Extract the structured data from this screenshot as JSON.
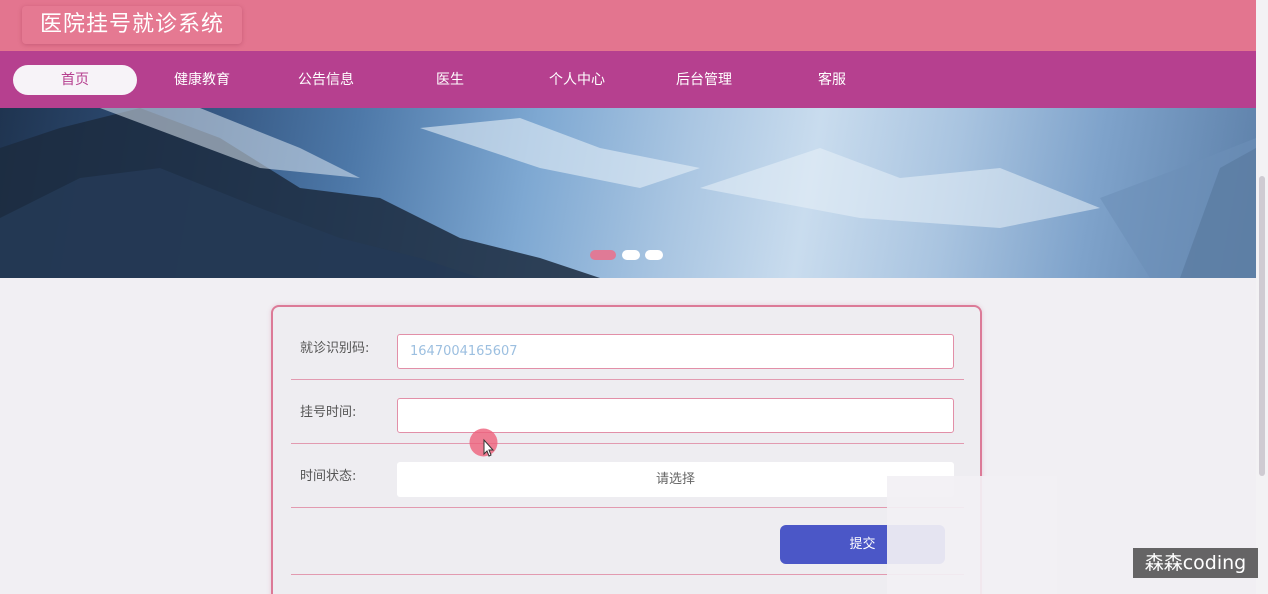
{
  "app": {
    "title": "医院挂号就诊系统"
  },
  "nav": {
    "items": [
      {
        "label": "首页",
        "active": true
      },
      {
        "label": "健康教育"
      },
      {
        "label": "公告信息"
      },
      {
        "label": "医生"
      },
      {
        "label": "个人中心"
      },
      {
        "label": "后台管理"
      },
      {
        "label": "客服"
      }
    ]
  },
  "banner": {
    "slide_count": 3,
    "active_slide": 1
  },
  "form": {
    "visit_code_label": "就诊识别码:",
    "visit_code_value": "1647004165607",
    "register_time_label": "挂号时间:",
    "register_time_value": "",
    "time_status_label": "时间状态:",
    "time_status_placeholder": "请选择",
    "submit_label": "提交"
  },
  "watermark": {
    "text": "森森coding"
  },
  "colors": {
    "header": "#e3758f",
    "nav": "#b6408f",
    "accent": "#e28fa8",
    "submit": "#4b57c7"
  }
}
